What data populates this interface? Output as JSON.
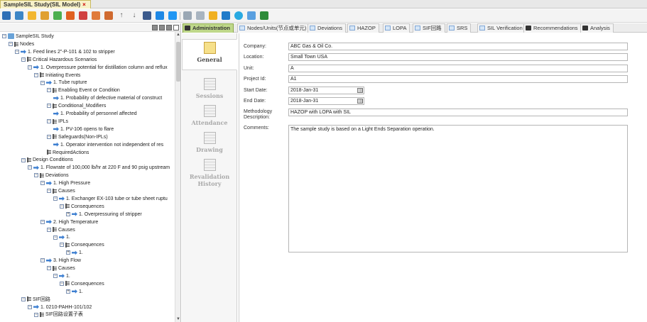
{
  "window": {
    "tab_title": "SampleSIL Study(SIL Model)",
    "close_glyph": "×"
  },
  "toolbar": {
    "icons": [
      "save-icon",
      "edit-icon",
      "folder-icon",
      "draw-icon",
      "add-icon",
      "fire-icon",
      "hazard-icon",
      "copy-icon",
      "paste-icon",
      "move-up-icon",
      "move-down-icon",
      "delete-icon",
      "link-icon",
      "table-icon",
      "grid-icon",
      "chart-icon",
      "warning-icon",
      "refresh-icon",
      "info-icon",
      "zoom-icon",
      "excel-icon"
    ],
    "arrow_up_glyph": "↑",
    "arrow_down_glyph": "↓"
  },
  "tree": {
    "nodes": [
      {
        "label": "SampleSIL Study",
        "level": 0,
        "icon": "study-icon",
        "toggle": "−"
      },
      {
        "label": "Nodes",
        "level": 1,
        "icon": "list-icon",
        "toggle": "−"
      },
      {
        "label": "1. Feed lines 2\"-P-101 & 102 to stripper",
        "level": 2,
        "icon": "node-icon",
        "toggle": "−"
      },
      {
        "label": "Critical Hazardous Scenarios",
        "level": 3,
        "icon": "list-icon",
        "toggle": "−"
      },
      {
        "label": "1. Overpressure potential for distillation column and reflux",
        "level": 4,
        "icon": "node-icon",
        "toggle": "−"
      },
      {
        "label": "Initiating Events",
        "level": 5,
        "icon": "list-icon",
        "toggle": "−"
      },
      {
        "label": "1. Tube rupture",
        "level": 6,
        "icon": "node-icon",
        "toggle": "−"
      },
      {
        "label": "Enabling Event or Condition",
        "level": 7,
        "icon": "list-icon",
        "toggle": "−"
      },
      {
        "label": "1. Probability of defective material of construct",
        "level": 8,
        "icon": "node-icon",
        "toggle": ""
      },
      {
        "label": "Conditional_Modifiers",
        "level": 7,
        "icon": "list-icon",
        "toggle": "−"
      },
      {
        "label": "1. Probability of personnel affected",
        "level": 8,
        "icon": "node-icon",
        "toggle": ""
      },
      {
        "label": "IPLs",
        "level": 7,
        "icon": "list-icon",
        "toggle": "−"
      },
      {
        "label": "1. PV-106 opens to flare",
        "level": 8,
        "icon": "node-icon",
        "toggle": ""
      },
      {
        "label": "Safeguards(Non-IPLs)",
        "level": 7,
        "icon": "list-icon",
        "toggle": "−"
      },
      {
        "label": "1. Operator intervention not independent of res",
        "level": 8,
        "icon": "node-icon",
        "toggle": ""
      },
      {
        "label": "RequiredActions",
        "level": 7,
        "icon": "list-icon",
        "toggle": ""
      },
      {
        "label": "Design Conditions",
        "level": 3,
        "icon": "list-icon",
        "toggle": "−"
      },
      {
        "label": "1. Flowrate of 100,000 lb/hr at 220 F and 90 psig upstream",
        "level": 4,
        "icon": "node-icon",
        "toggle": "−"
      },
      {
        "label": "Deviations",
        "level": 5,
        "icon": "list-icon",
        "toggle": "−"
      },
      {
        "label": "1. High Pressure",
        "level": 6,
        "icon": "node-icon",
        "toggle": "−"
      },
      {
        "label": "Causes",
        "level": 7,
        "icon": "list-icon",
        "toggle": "−"
      },
      {
        "label": "1. Exchanger EX-103 tube or tube sheet ruptu",
        "level": 8,
        "icon": "node-icon",
        "toggle": "−"
      },
      {
        "label": "Consequences",
        "level": 9,
        "icon": "list-icon",
        "toggle": "−"
      },
      {
        "label": "1. Overpressuring of stripper",
        "level": 10,
        "icon": "node-icon",
        "toggle": "+"
      },
      {
        "label": "2. High Temperature",
        "level": 6,
        "icon": "node-icon",
        "toggle": "−"
      },
      {
        "label": "Causes",
        "level": 7,
        "icon": "list-icon",
        "toggle": "−"
      },
      {
        "label": "1.",
        "level": 8,
        "icon": "node-icon",
        "toggle": "−"
      },
      {
        "label": "Consequences",
        "level": 9,
        "icon": "list-icon",
        "toggle": "−"
      },
      {
        "label": "1.",
        "level": 10,
        "icon": "node-icon",
        "toggle": "+"
      },
      {
        "label": "3. High Flow",
        "level": 6,
        "icon": "node-icon",
        "toggle": "−"
      },
      {
        "label": "Causes",
        "level": 7,
        "icon": "list-icon",
        "toggle": "−"
      },
      {
        "label": "1.",
        "level": 8,
        "icon": "node-icon",
        "toggle": "−"
      },
      {
        "label": "Consequences",
        "level": 9,
        "icon": "list-icon",
        "toggle": "−"
      },
      {
        "label": "1.",
        "level": 10,
        "icon": "node-icon",
        "toggle": "+"
      },
      {
        "label": "SIF回路",
        "level": 3,
        "icon": "list-icon",
        "toggle": "−"
      },
      {
        "label": "1. 0210-PAHH-101/102",
        "level": 4,
        "icon": "node-icon",
        "toggle": "−"
      },
      {
        "label": "SIF回路设置子表",
        "level": 5,
        "icon": "list-icon",
        "toggle": "−"
      }
    ]
  },
  "tabs": [
    {
      "label": "Administration",
      "active": true,
      "icon": "dark"
    },
    {
      "label": "Nodes/Units(节点或单元)",
      "active": false,
      "icon": "light"
    },
    {
      "label": "Deviations",
      "active": false,
      "icon": "light"
    },
    {
      "label": "HAZOP",
      "active": false,
      "icon": "light"
    },
    {
      "label": "LOPA",
      "active": false,
      "icon": "light"
    },
    {
      "label": "SIF回路",
      "active": false,
      "icon": "light"
    },
    {
      "label": "SRS",
      "active": false,
      "icon": "light"
    },
    {
      "label": "SIL Verification",
      "active": false,
      "icon": "light"
    },
    {
      "label": "Recommendations",
      "active": false,
      "icon": "dark"
    },
    {
      "label": "Analysis",
      "active": false,
      "icon": "dark"
    }
  ],
  "side_nav": [
    {
      "label": "General",
      "active": true
    },
    {
      "label": "Sessions",
      "active": false
    },
    {
      "label": "Attendance",
      "active": false
    },
    {
      "label": "Drawing",
      "active": false
    },
    {
      "label": "Revalidation History",
      "active": false
    }
  ],
  "form": {
    "company": {
      "label": "Company:",
      "value": "ABC Gas & Oil Co."
    },
    "location": {
      "label": "Location:",
      "value": "Small Town USA"
    },
    "unit": {
      "label": "Unit:",
      "value": "A"
    },
    "project_id": {
      "label": "Project Id:",
      "value": "A1"
    },
    "start_date": {
      "label": "Start Date:",
      "value": "2018-Jan-31"
    },
    "end_date": {
      "label": "End Date:",
      "value": "2018-Jan-31"
    },
    "methodology": {
      "label_line1": "Methodology",
      "label_line2": "Description:",
      "value": "HAZOP with LOPA with SIL"
    },
    "comments": {
      "label": "Comments:",
      "value": "The sample study is based on a Light Ends Separation operation."
    }
  },
  "colors": {
    "active_tab": "#bfd88a",
    "doc_tab": "#f7f1c8",
    "node_icon": "#3d7fd1",
    "general_icon": "#f6e08a"
  }
}
